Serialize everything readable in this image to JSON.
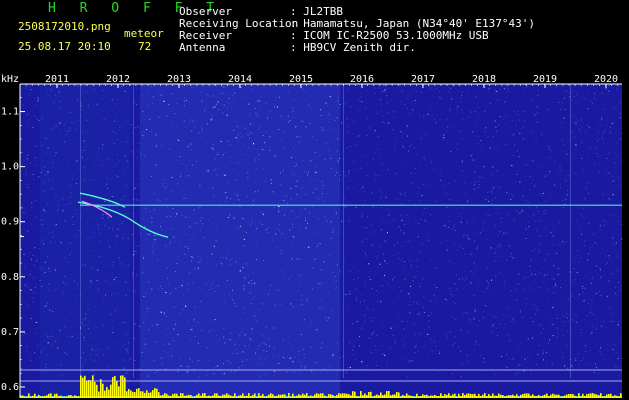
{
  "header": {
    "brand": "H R O F F T",
    "filename": "2508172010.png",
    "mode": "meteor",
    "datetime": "25.08.17 20:10",
    "count": "72",
    "observer_label": "Observer",
    "observer_value": ": JL2TBB",
    "location_label": "Receiving Location",
    "location_value": ": Hamamatsu, Japan (N34°40' E137°43')",
    "receiver_label": "Receiver",
    "receiver_value": ": ICOM IC-R2500 53.1000MHz USB",
    "antenna_label": "Antenna",
    "antenna_value": ": HB9CV Zenith dir."
  },
  "chart_data": {
    "type": "heatmap",
    "ylabel": "kHz",
    "x_ticks": [
      "2011",
      "2012",
      "2013",
      "2014",
      "2015",
      "2016",
      "2017",
      "2018",
      "2019",
      "2020"
    ],
    "y_ticks": [
      "1.1",
      "1.0",
      "0.9",
      "0.8",
      "0.7",
      "0.6"
    ],
    "ylim": [
      0.58,
      1.15
    ],
    "carrier_khz": 0.93,
    "colors": {
      "background": "#1a1aa0",
      "noise": "#6a9cff",
      "trace": "#55ffcc",
      "level": "#ffff00"
    }
  }
}
